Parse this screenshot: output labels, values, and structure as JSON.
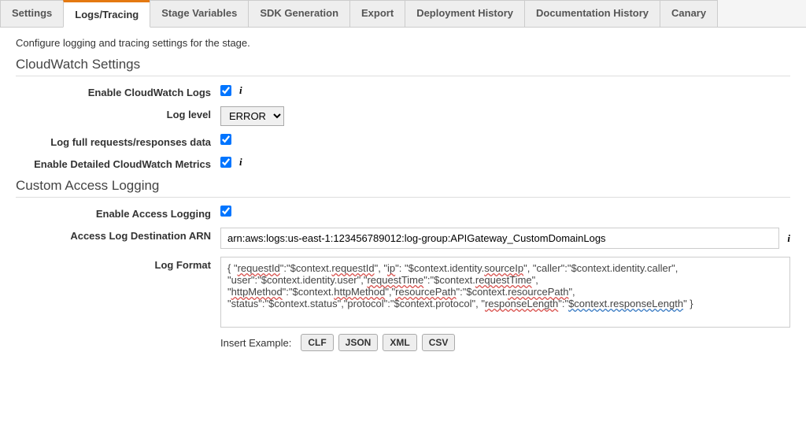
{
  "tabs": [
    {
      "label": "Settings"
    },
    {
      "label": "Logs/Tracing",
      "active": true
    },
    {
      "label": "Stage Variables"
    },
    {
      "label": "SDK Generation"
    },
    {
      "label": "Export"
    },
    {
      "label": "Deployment History"
    },
    {
      "label": "Documentation History"
    },
    {
      "label": "Canary"
    }
  ],
  "intro": "Configure logging and tracing settings for the stage.",
  "sections": {
    "cloudwatch": {
      "title": "CloudWatch Settings",
      "enable_logs_label": "Enable CloudWatch Logs",
      "log_level_label": "Log level",
      "log_level_value": "ERROR",
      "log_full_label": "Log full requests/responses data",
      "detailed_metrics_label": "Enable Detailed CloudWatch Metrics"
    },
    "access_logging": {
      "title": "Custom Access Logging",
      "enable_label": "Enable Access Logging",
      "arn_label": "Access Log Destination ARN",
      "arn_value": "arn:aws:logs:us-east-1:123456789012:log-group:APIGateway_CustomDomainLogs",
      "log_format_label": "Log Format",
      "log_format_value": "{ \"requestId\":\"$context.requestId\", \"ip\": \"$context.identity.sourceIp\", \"caller\":\"$context.identity.caller\", \"user\":\"$context.identity.user\",\"requestTime\":\"$context.requestTime\", \"httpMethod\":\"$context.httpMethod\",\"resourcePath\":\"$context.resourcePath\", \"status\":\"$context.status\",\"protocol\":\"$context.protocol\", \"responseLength\":\"$context.responseLength\" }",
      "insert_label": "Insert Example:",
      "buttons": [
        "CLF",
        "JSON",
        "XML",
        "CSV"
      ]
    }
  }
}
